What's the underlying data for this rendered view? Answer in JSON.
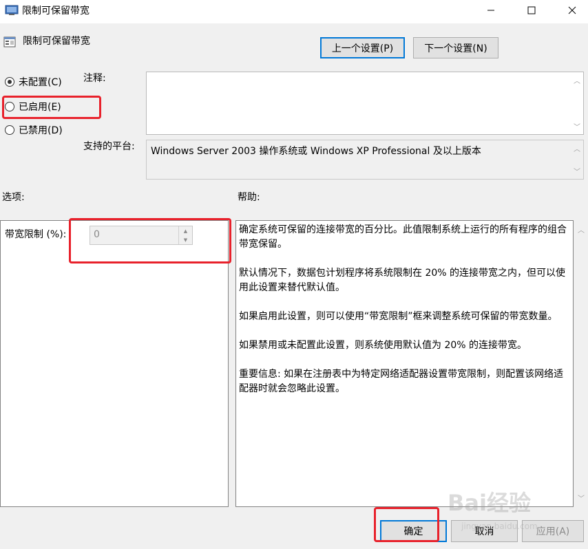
{
  "window": {
    "title": "限制可保留带宽",
    "controls": [
      "minimize",
      "maximize",
      "close"
    ]
  },
  "header": {
    "title": "限制可保留带宽",
    "prev_button": "上一个设置(P)",
    "next_button": "下一个设置(N)"
  },
  "state": {
    "options": [
      {
        "label": "未配置(C)",
        "selected": true
      },
      {
        "label": "已启用(E)",
        "selected": false
      },
      {
        "label": "已禁用(D)",
        "selected": false
      }
    ]
  },
  "comment": {
    "label": "注释:",
    "value": ""
  },
  "platform": {
    "label": "支持的平台:",
    "value": "Windows Server 2003 操作系统或 Windows XP Professional 及以上版本"
  },
  "options_panel": {
    "header": "选项:",
    "bandwidth_label": "带宽限制 (%):",
    "bandwidth_value": "0"
  },
  "help_panel": {
    "header": "帮助:",
    "paragraphs": [
      "确定系统可保留的连接带宽的百分比。此值限制系统上运行的所有程序的组合带宽保留。",
      "默认情况下，数据包计划程序将系统限制在 20% 的连接带宽之内，但可以使用此设置来替代默认值。",
      "如果启用此设置，则可以使用“带宽限制”框来调整系统可保留的带宽数量。",
      "如果禁用或未配置此设置，则系统使用默认值为 20% 的连接带宽。",
      "重要信息: 如果在注册表中为特定网络适配器设置带宽限制，则配置该网络适配器时就会忽略此设置。"
    ]
  },
  "footer": {
    "ok_button": "确定",
    "cancel_button": "取消",
    "apply_button": "应用(A)"
  },
  "watermark": {
    "text": "Bai经验",
    "url": "jingyan.baidu.com"
  },
  "colors": {
    "annotation": "#e8212b",
    "focus_border": "#0078d7"
  }
}
